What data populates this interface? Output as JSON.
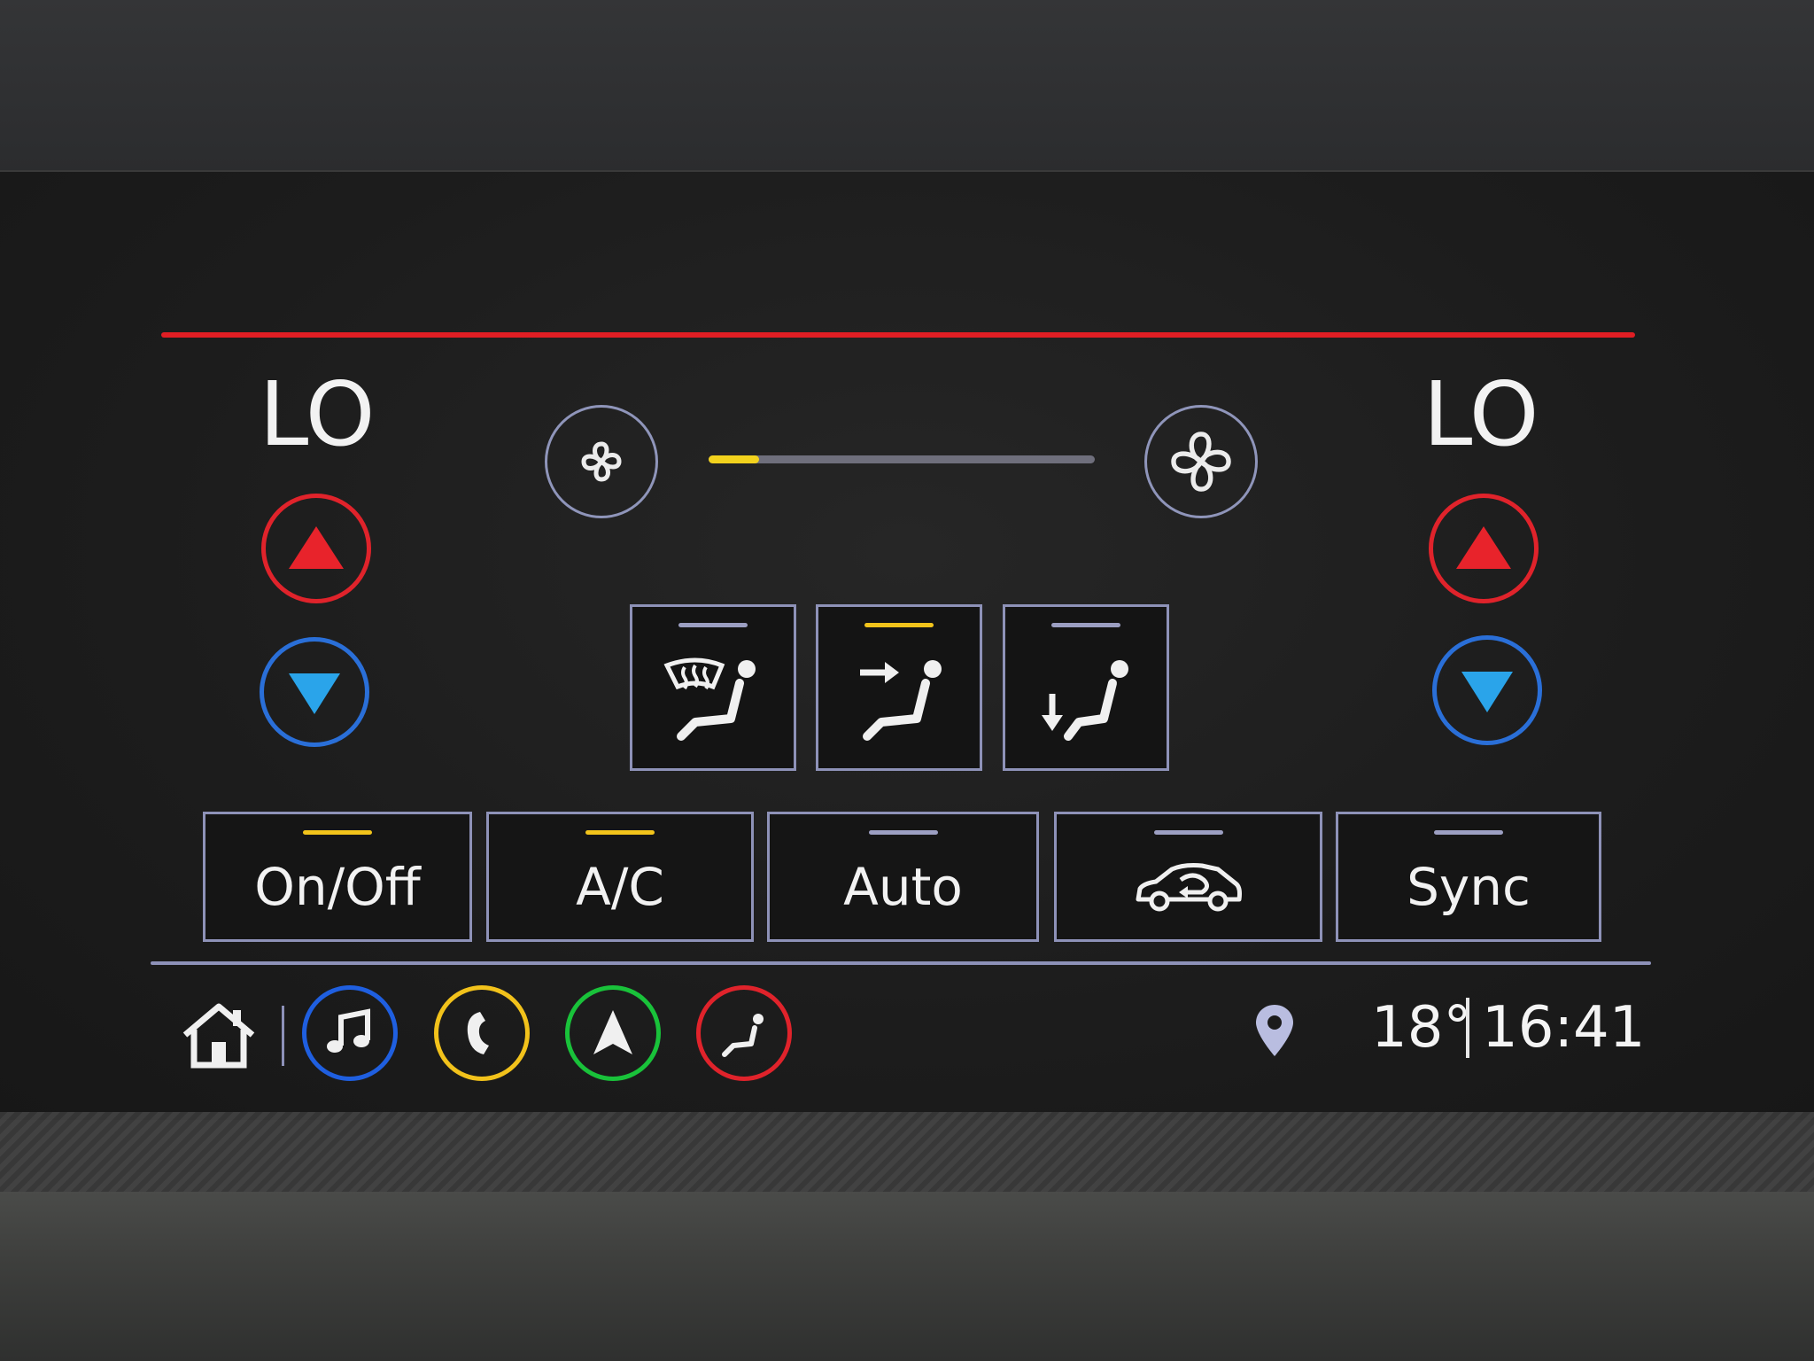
{
  "climate": {
    "left_temp": "LO",
    "right_temp": "LO",
    "fan_speed_fraction": 0.13,
    "air_modes": [
      {
        "name": "windshield-defrost",
        "active": false
      },
      {
        "name": "face-vent",
        "active": true
      },
      {
        "name": "floor-vent",
        "active": false
      }
    ],
    "controls": {
      "on_off_label": "On/Off",
      "on_off_active": true,
      "ac_label": "A/C",
      "ac_active": true,
      "auto_label": "Auto",
      "auto_active": false,
      "recirc_icon": "recirculation-icon",
      "recirc_active": false,
      "sync_label": "Sync",
      "sync_active": false
    }
  },
  "status_bar": {
    "outside_temp": "18°",
    "time": "16:41"
  },
  "nav": {
    "items": [
      {
        "icon": "music-note-icon",
        "color": "#1f5fe0"
      },
      {
        "icon": "phone-icon",
        "color": "#f2c21b"
      },
      {
        "icon": "navigation-arrow-icon",
        "color": "#19c23a"
      },
      {
        "icon": "seat-climate-icon",
        "color": "#e0232b"
      }
    ]
  },
  "colors": {
    "accent_red": "#e01e24",
    "active_indicator": "#f2c41b",
    "inactive_indicator": "#9c9fc2",
    "button_border": "#8e92b8"
  }
}
